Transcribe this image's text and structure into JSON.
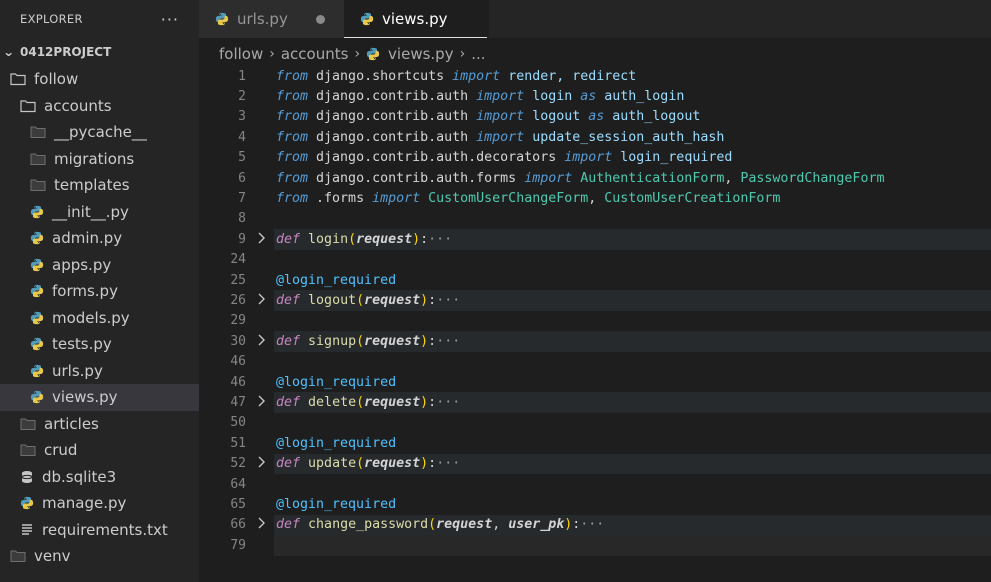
{
  "sidebar": {
    "title": "EXPLORER",
    "more": "···",
    "project": "0412PROJECT",
    "items": [
      {
        "label": "follow",
        "type": "folder",
        "open": true,
        "indent": 0
      },
      {
        "label": "accounts",
        "type": "folder",
        "open": true,
        "indent": 1
      },
      {
        "label": "__pycache__",
        "type": "folder",
        "open": false,
        "indent": 2
      },
      {
        "label": "migrations",
        "type": "folder",
        "open": false,
        "indent": 2
      },
      {
        "label": "templates",
        "type": "folder",
        "open": false,
        "indent": 2
      },
      {
        "label": "__init__.py",
        "type": "python",
        "indent": 2
      },
      {
        "label": "admin.py",
        "type": "python",
        "indent": 2
      },
      {
        "label": "apps.py",
        "type": "python",
        "indent": 2
      },
      {
        "label": "forms.py",
        "type": "python",
        "indent": 2
      },
      {
        "label": "models.py",
        "type": "python",
        "indent": 2
      },
      {
        "label": "tests.py",
        "type": "python",
        "indent": 2
      },
      {
        "label": "urls.py",
        "type": "python",
        "indent": 2
      },
      {
        "label": "views.py",
        "type": "python",
        "indent": 2,
        "active": true
      },
      {
        "label": "articles",
        "type": "folder",
        "open": false,
        "indent": 1
      },
      {
        "label": "crud",
        "type": "folder",
        "open": false,
        "indent": 1
      },
      {
        "label": "db.sqlite3",
        "type": "db",
        "indent": 1
      },
      {
        "label": "manage.py",
        "type": "python",
        "indent": 1
      },
      {
        "label": "requirements.txt",
        "type": "text",
        "indent": 1
      },
      {
        "label": "venv",
        "type": "folder",
        "open": false,
        "indent": 0
      }
    ]
  },
  "tabs": [
    {
      "label": "urls.py",
      "active": false,
      "modified": true
    },
    {
      "label": "views.py",
      "active": true,
      "modified": true
    }
  ],
  "breadcrumb": {
    "parts": [
      "follow",
      "accounts",
      "views.py",
      "..."
    ]
  },
  "editor": {
    "lines": [
      {
        "n": "1",
        "tokens": [
          [
            "from",
            "kw"
          ],
          [
            " django.shortcuts ",
            "mod"
          ],
          [
            "import",
            "kw"
          ],
          [
            " render, redirect",
            "imp"
          ]
        ]
      },
      {
        "n": "2",
        "tokens": [
          [
            "from",
            "kw"
          ],
          [
            " django.contrib.auth ",
            "mod"
          ],
          [
            "import",
            "kw"
          ],
          [
            " login ",
            "imp"
          ],
          [
            "as",
            "kw"
          ],
          [
            " auth_login",
            "imp"
          ]
        ]
      },
      {
        "n": "3",
        "tokens": [
          [
            "from",
            "kw"
          ],
          [
            " django.contrib.auth ",
            "mod"
          ],
          [
            "import",
            "kw"
          ],
          [
            " logout ",
            "imp"
          ],
          [
            "as",
            "kw"
          ],
          [
            " auth_logout",
            "imp"
          ]
        ]
      },
      {
        "n": "4",
        "tokens": [
          [
            "from",
            "kw"
          ],
          [
            " django.contrib.auth ",
            "mod"
          ],
          [
            "import",
            "kw"
          ],
          [
            " update_session_auth_hash",
            "imp"
          ]
        ]
      },
      {
        "n": "5",
        "tokens": [
          [
            "from",
            "kw"
          ],
          [
            " django.contrib.auth.decorators ",
            "mod"
          ],
          [
            "import",
            "kw"
          ],
          [
            " login_required",
            "imp"
          ]
        ]
      },
      {
        "n": "6",
        "tokens": [
          [
            "from",
            "kw"
          ],
          [
            " django.contrib.auth.forms ",
            "mod"
          ],
          [
            "import",
            "kw"
          ],
          [
            " AuthenticationForm",
            "cls"
          ],
          [
            ", ",
            "mod"
          ],
          [
            "PasswordChangeForm",
            "cls"
          ]
        ]
      },
      {
        "n": "7",
        "tokens": [
          [
            "from",
            "kw"
          ],
          [
            " .forms ",
            "mod"
          ],
          [
            "import",
            "kw"
          ],
          [
            " CustomUserChangeForm",
            "cls"
          ],
          [
            ", ",
            "mod"
          ],
          [
            "CustomUserCreationForm",
            "cls"
          ]
        ]
      },
      {
        "n": "8",
        "tokens": []
      },
      {
        "n": "9",
        "fold": true,
        "tokens": [
          [
            "def",
            "kwp"
          ],
          [
            " ",
            "mod"
          ],
          [
            "login",
            "fn"
          ],
          [
            "(",
            "paren"
          ],
          [
            "request",
            "prm"
          ],
          [
            ")",
            "paren"
          ],
          [
            ":",
            "mod"
          ],
          [
            "···",
            "ell"
          ]
        ]
      },
      {
        "n": "24",
        "tokens": []
      },
      {
        "n": "25",
        "tokens": [
          [
            "@login_required",
            "dec"
          ]
        ]
      },
      {
        "n": "26",
        "fold": true,
        "tokens": [
          [
            "def",
            "kwp"
          ],
          [
            " ",
            "mod"
          ],
          [
            "logout",
            "fn"
          ],
          [
            "(",
            "paren"
          ],
          [
            "request",
            "prm"
          ],
          [
            ")",
            "paren"
          ],
          [
            ":",
            "mod"
          ],
          [
            "···",
            "ell"
          ]
        ]
      },
      {
        "n": "29",
        "tokens": []
      },
      {
        "n": "30",
        "fold": true,
        "tokens": [
          [
            "def",
            "kwp"
          ],
          [
            " ",
            "mod"
          ],
          [
            "signup",
            "fn"
          ],
          [
            "(",
            "paren"
          ],
          [
            "request",
            "prm"
          ],
          [
            ")",
            "paren"
          ],
          [
            ":",
            "mod"
          ],
          [
            "···",
            "ell"
          ]
        ]
      },
      {
        "n": "46",
        "tokens": []
      },
      {
        "n": "46",
        "tokens": [
          [
            "@login_required",
            "dec"
          ]
        ]
      },
      {
        "n": "47",
        "fold": true,
        "tokens": [
          [
            "def",
            "kwp"
          ],
          [
            " ",
            "mod"
          ],
          [
            "delete",
            "fn"
          ],
          [
            "(",
            "paren"
          ],
          [
            "request",
            "prm"
          ],
          [
            ")",
            "paren"
          ],
          [
            ":",
            "mod"
          ],
          [
            "···",
            "ell"
          ]
        ]
      },
      {
        "n": "50",
        "tokens": []
      },
      {
        "n": "51",
        "tokens": [
          [
            "@login_required",
            "dec"
          ]
        ]
      },
      {
        "n": "52",
        "fold": true,
        "tokens": [
          [
            "def",
            "kwp"
          ],
          [
            " ",
            "mod"
          ],
          [
            "update",
            "fn"
          ],
          [
            "(",
            "paren"
          ],
          [
            "request",
            "prm"
          ],
          [
            ")",
            "paren"
          ],
          [
            ":",
            "mod"
          ],
          [
            "···",
            "ell"
          ]
        ]
      },
      {
        "n": "64",
        "tokens": []
      },
      {
        "n": "65",
        "tokens": [
          [
            "@login_required",
            "dec"
          ]
        ]
      },
      {
        "n": "66",
        "fold": true,
        "tokens": [
          [
            "def",
            "kwp"
          ],
          [
            " ",
            "mod"
          ],
          [
            "change_password",
            "fn"
          ],
          [
            "(",
            "paren"
          ],
          [
            "request",
            "prm"
          ],
          [
            ", ",
            "mod"
          ],
          [
            "user_pk",
            "prm"
          ],
          [
            ")",
            "paren"
          ],
          [
            ":",
            "mod"
          ],
          [
            "···",
            "ell"
          ]
        ]
      },
      {
        "n": "79",
        "current": true,
        "tokens": []
      }
    ]
  }
}
